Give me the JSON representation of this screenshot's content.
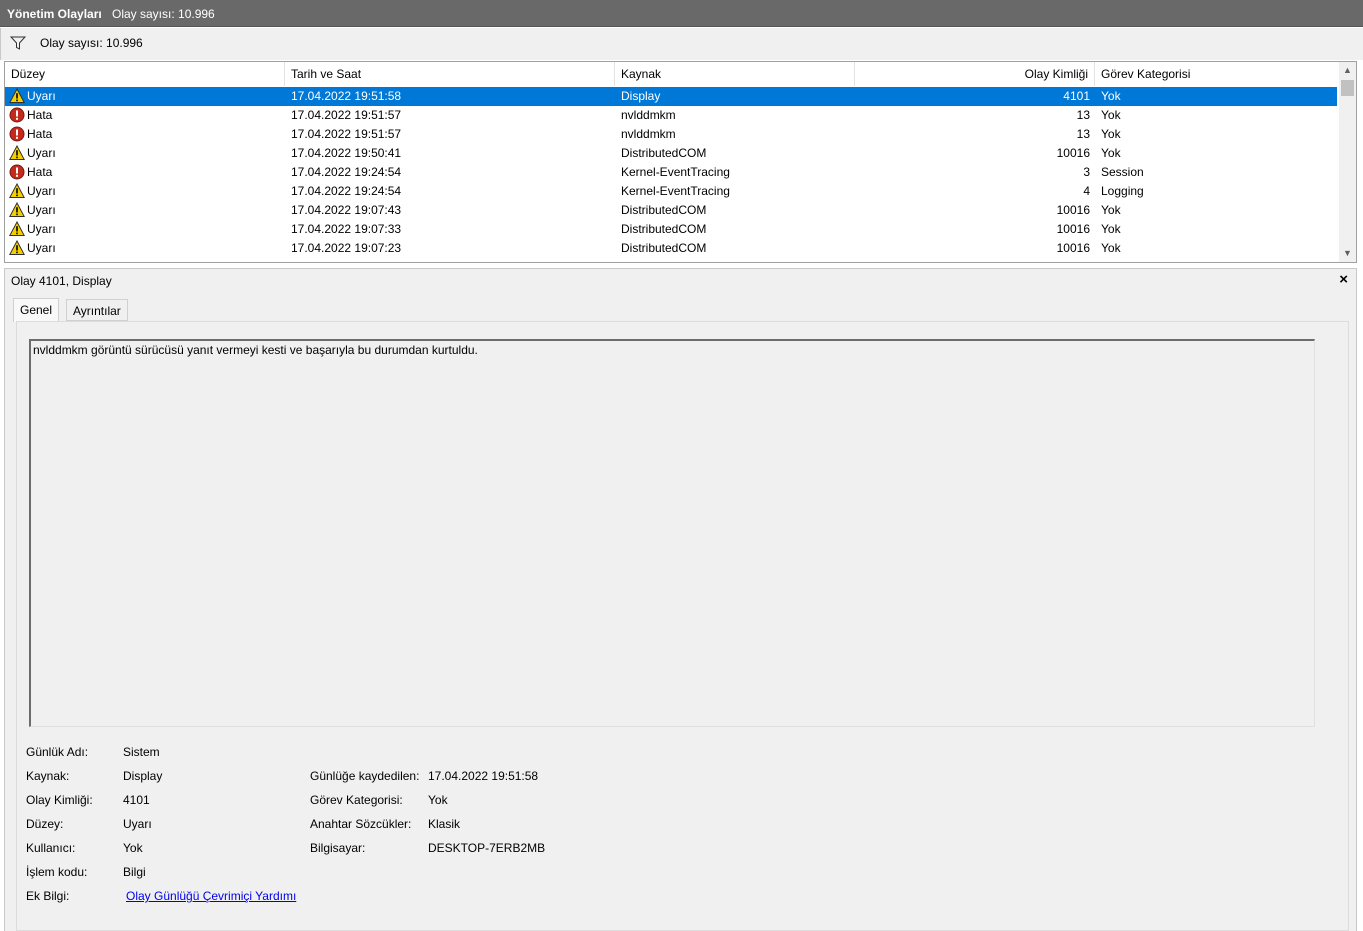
{
  "titlebar": {
    "title": "Yönetim Olayları",
    "count_text": "Olay sayısı: 10.996"
  },
  "filterbar": {
    "icon": "filter-icon",
    "count_text": "Olay sayısı: 10.996"
  },
  "table": {
    "columns": [
      "Düzey",
      "Tarih ve Saat",
      "Kaynak",
      "Olay Kimliği",
      "Görev Kategorisi"
    ],
    "rows": [
      {
        "level": "Uyarı",
        "icon": "warning-icon",
        "date": "17.04.2022 19:51:58",
        "source": "Display",
        "id": "4101",
        "category": "Yok",
        "selected": true
      },
      {
        "level": "Hata",
        "icon": "error-icon",
        "date": "17.04.2022 19:51:57",
        "source": "nvlddmkm",
        "id": "13",
        "category": "Yok"
      },
      {
        "level": "Hata",
        "icon": "error-icon",
        "date": "17.04.2022 19:51:57",
        "source": "nvlddmkm",
        "id": "13",
        "category": "Yok"
      },
      {
        "level": "Uyarı",
        "icon": "warning-icon",
        "date": "17.04.2022 19:50:41",
        "source": "DistributedCOM",
        "id": "10016",
        "category": "Yok"
      },
      {
        "level": "Hata",
        "icon": "error-icon",
        "date": "17.04.2022 19:24:54",
        "source": "Kernel-EventTracing",
        "id": "3",
        "category": "Session"
      },
      {
        "level": "Uyarı",
        "icon": "warning-icon",
        "date": "17.04.2022 19:24:54",
        "source": "Kernel-EventTracing",
        "id": "4",
        "category": "Logging"
      },
      {
        "level": "Uyarı",
        "icon": "warning-icon",
        "date": "17.04.2022 19:07:43",
        "source": "DistributedCOM",
        "id": "10016",
        "category": "Yok"
      },
      {
        "level": "Uyarı",
        "icon": "warning-icon",
        "date": "17.04.2022 19:07:33",
        "source": "DistributedCOM",
        "id": "10016",
        "category": "Yok"
      },
      {
        "level": "Uyarı",
        "icon": "warning-icon",
        "date": "17.04.2022 19:07:23",
        "source": "DistributedCOM",
        "id": "10016",
        "category": "Yok"
      }
    ],
    "selection_color": "#0078d7"
  },
  "detail": {
    "title": "Olay 4101, Display",
    "close_label": "×",
    "tabs": [
      "Genel",
      "Ayrıntılar"
    ],
    "message": "nvlddmkm görüntü sürücüsü yanıt vermeyi kesti ve başarıyla bu durumdan kurtuldu.",
    "props": {
      "log_name_label": "Günlük Adı:",
      "log_name": "Sistem",
      "source_label": "Kaynak:",
      "source": "Display",
      "event_id_label": "Olay Kimliği:",
      "event_id": "4101",
      "level_label": "Düzey:",
      "level": "Uyarı",
      "user_label": "Kullanıcı:",
      "user": "Yok",
      "opcode_label": "İşlem kodu:",
      "opcode": "Bilgi",
      "more_info_label": "Ek Bilgi:",
      "more_info_link": "Olay Günlüğü Çevrimiçi Yardımı",
      "logged_label": "Günlüğe kaydedilen:",
      "logged": "17.04.2022 19:51:58",
      "task_label": "Görev Kategorisi:",
      "task": "Yok",
      "keywords_label": "Anahtar Sözcükler:",
      "keywords": "Klasik",
      "computer_label": "Bilgisayar:",
      "computer": "DESKTOP-7ERB2MB"
    }
  }
}
